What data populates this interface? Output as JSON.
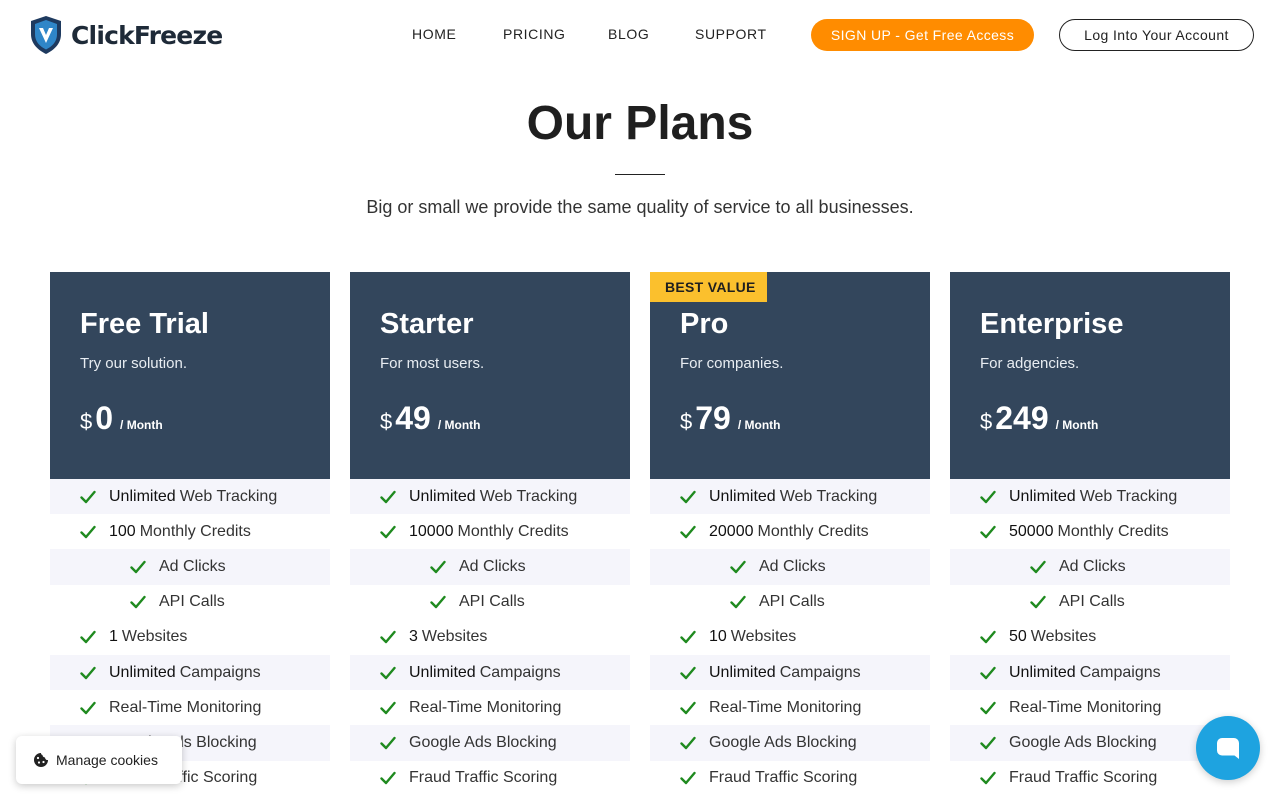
{
  "brand": {
    "name": "ClickFreeze",
    "accent": "#ff8c00",
    "shield_color": "#1e3a5f"
  },
  "nav": {
    "items": [
      {
        "label": "HOME"
      },
      {
        "label": "PRICING"
      },
      {
        "label": "BLOG"
      },
      {
        "label": "SUPPORT"
      }
    ],
    "signup_label": "SIGN UP - Get Free Access",
    "login_label": "Log Into Your Account"
  },
  "hero": {
    "title": "Our Plans",
    "subtitle": "Big or small we provide the same quality of service to all businesses."
  },
  "plans": [
    {
      "name": "Free Trial",
      "description": "Try our solution.",
      "currency": "$",
      "price": "0",
      "period": "/ Month",
      "badge": "",
      "features": [
        {
          "strong": "Unlimited",
          "text": "Web Tracking"
        },
        {
          "strong": "100",
          "text": "Monthly Credits"
        },
        {
          "strong": "",
          "text": "Ad Clicks"
        },
        {
          "strong": "",
          "text": "API Calls"
        },
        {
          "strong": "1",
          "text": "Websites"
        },
        {
          "strong": "Unlimited",
          "text": "Campaigns"
        },
        {
          "strong": "",
          "text": "Real-Time Monitoring"
        },
        {
          "strong": "",
          "text": "Google Ads Blocking"
        },
        {
          "strong": "",
          "text": "Fraud Traffic Scoring"
        }
      ]
    },
    {
      "name": "Starter",
      "description": "For most users.",
      "currency": "$",
      "price": "49",
      "period": "/ Month",
      "badge": "",
      "features": [
        {
          "strong": "Unlimited",
          "text": "Web Tracking"
        },
        {
          "strong": "10000",
          "text": "Monthly Credits"
        },
        {
          "strong": "",
          "text": "Ad Clicks"
        },
        {
          "strong": "",
          "text": "API Calls"
        },
        {
          "strong": "3",
          "text": "Websites"
        },
        {
          "strong": "Unlimited",
          "text": "Campaigns"
        },
        {
          "strong": "",
          "text": "Real-Time Monitoring"
        },
        {
          "strong": "",
          "text": "Google Ads Blocking"
        },
        {
          "strong": "",
          "text": "Fraud Traffic Scoring"
        }
      ]
    },
    {
      "name": "Pro",
      "description": "For companies.",
      "currency": "$",
      "price": "79",
      "period": "/ Month",
      "badge": "BEST VALUE",
      "features": [
        {
          "strong": "Unlimited",
          "text": "Web Tracking"
        },
        {
          "strong": "20000",
          "text": "Monthly Credits"
        },
        {
          "strong": "",
          "text": "Ad Clicks"
        },
        {
          "strong": "",
          "text": "API Calls"
        },
        {
          "strong": "10",
          "text": "Websites"
        },
        {
          "strong": "Unlimited",
          "text": "Campaigns"
        },
        {
          "strong": "",
          "text": "Real-Time Monitoring"
        },
        {
          "strong": "",
          "text": "Google Ads Blocking"
        },
        {
          "strong": "",
          "text": "Fraud Traffic Scoring"
        }
      ]
    },
    {
      "name": "Enterprise",
      "description": "For adgencies.",
      "currency": "$",
      "price": "249",
      "period": "/ Month",
      "badge": "",
      "features": [
        {
          "strong": "Unlimited",
          "text": "Web Tracking"
        },
        {
          "strong": "50000",
          "text": "Monthly Credits"
        },
        {
          "strong": "",
          "text": "Ad Clicks"
        },
        {
          "strong": "",
          "text": "API Calls"
        },
        {
          "strong": "50",
          "text": "Websites"
        },
        {
          "strong": "Unlimited",
          "text": "Campaigns"
        },
        {
          "strong": "",
          "text": "Real-Time Monitoring"
        },
        {
          "strong": "",
          "text": "Google Ads Blocking"
        },
        {
          "strong": "",
          "text": "Fraud Traffic Scoring"
        }
      ]
    }
  ],
  "cookies": {
    "label": "Manage cookies",
    "icon": "cookie-icon"
  },
  "chat": {
    "icon": "chat-bubble-icon",
    "color": "#1ea3e0"
  },
  "icons": {
    "check": "check-icon",
    "logo": "shield-logo-icon"
  }
}
